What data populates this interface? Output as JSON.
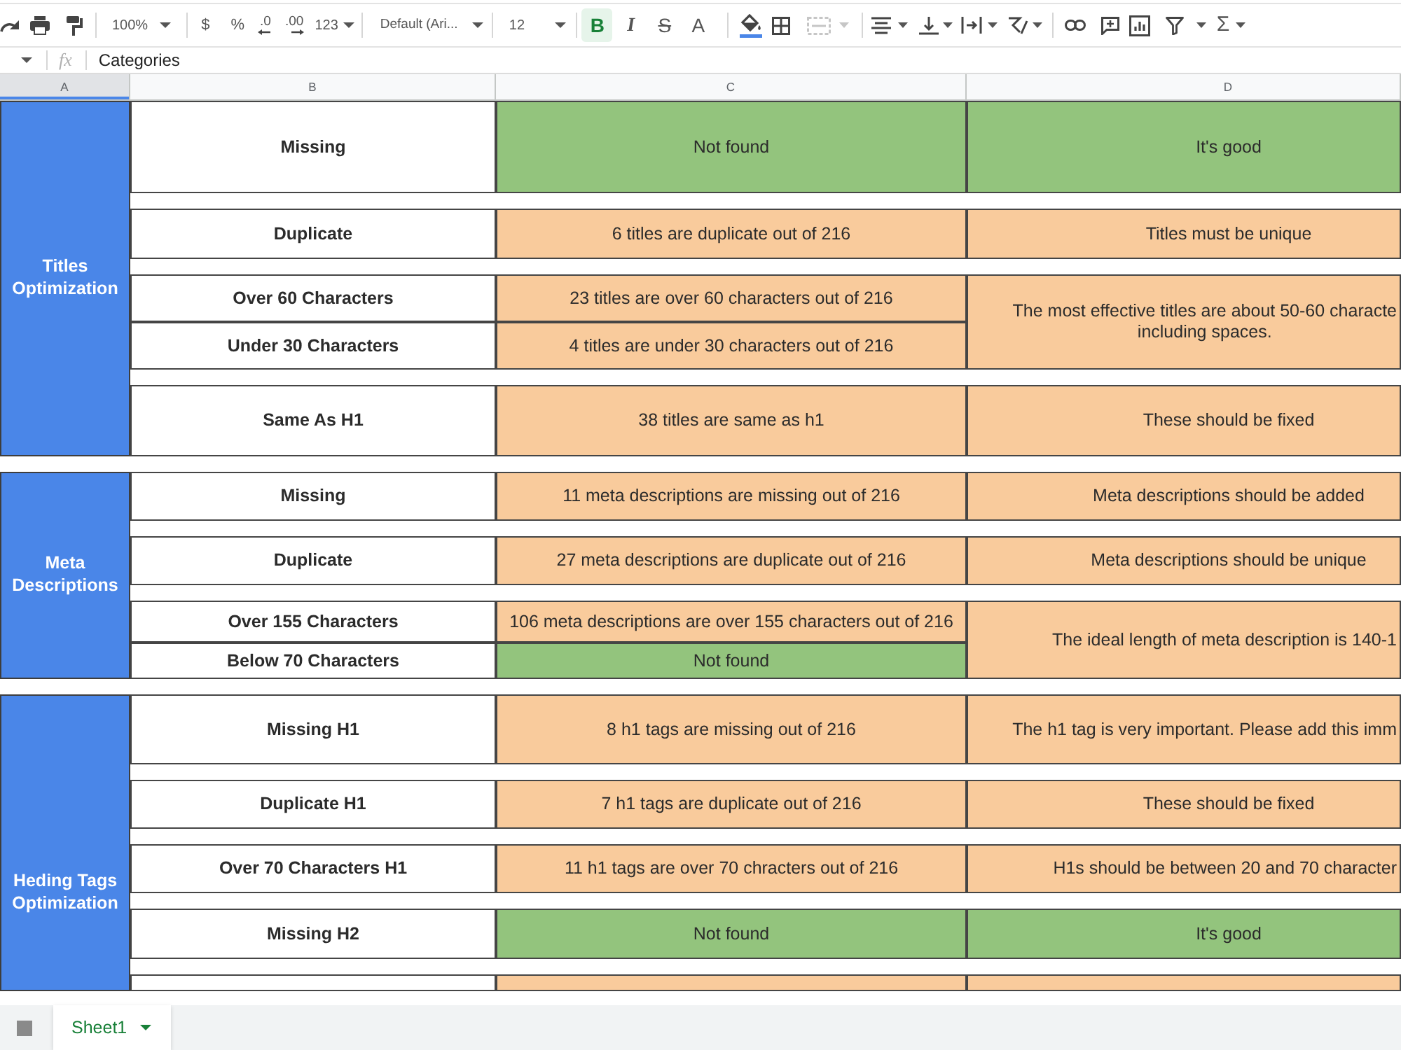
{
  "toolbar": {
    "zoom": "100%",
    "currency": "$",
    "percent": "%",
    "decrease_decimals": ".0",
    "increase_decimals": ".00",
    "number_formats": "123",
    "font": "Default (Ari...",
    "font_size": "12",
    "text_styles": [
      {
        "label": "B",
        "selected": true
      },
      {
        "label": "I",
        "selected": false
      },
      {
        "label": "S",
        "selected": false
      },
      {
        "label": "A",
        "selected": false
      }
    ],
    "merge": {
      "disabled": true
    },
    "functions": "Σ"
  },
  "formula_bar": {
    "label": "fx",
    "value": "Categories"
  },
  "columns": [
    {
      "label": "A",
      "selected": true
    },
    {
      "label": "B",
      "selected": false
    },
    {
      "label": "C",
      "selected": false
    },
    {
      "label": "D",
      "selected": false
    }
  ],
  "groups": [
    {
      "category": "Titles Optimization",
      "blocks": [
        {
          "rows": [
            {
              "check": "Missing",
              "result": "Not found",
              "color": "#93c47d"
            }
          ],
          "advice": {
            "text": "It's good",
            "color": "#93c47d"
          }
        },
        {
          "rows": [
            {
              "check": "Duplicate",
              "result": "6 titles are duplicate out of 216",
              "color": "#f9cb9c"
            }
          ],
          "advice": {
            "text": "Titles must be unique",
            "color": "#f9cb9c"
          }
        },
        {
          "rows": [
            {
              "check": "Over 60 Characters",
              "result": "23 titles are over 60 characters out of 216",
              "color": "#f9cb9c"
            },
            {
              "check": "Under 30 Characters",
              "result": "4 titles are under 30 characters out of 216",
              "color": "#f9cb9c"
            }
          ],
          "advice": {
            "text": "The most effective titles are about 50-60 characte\nincluding spaces.",
            "color": "#f9cb9c"
          }
        },
        {
          "rows": [
            {
              "check": "Same As H1",
              "result": "38 titles are same as h1",
              "color": "#f9cb9c"
            }
          ],
          "advice": {
            "text": "These should be fixed",
            "color": "#f9cb9c"
          }
        }
      ]
    },
    {
      "category": "Meta Descriptions",
      "blocks": [
        {
          "rows": [
            {
              "check": "Missing",
              "result": "11 meta descriptions are missing out of 216",
              "color": "#f9cb9c"
            }
          ],
          "advice": {
            "text": "Meta descriptions should be added",
            "color": "#f9cb9c"
          }
        },
        {
          "rows": [
            {
              "check": "Duplicate",
              "result": "27 meta descriptions are duplicate out of 216",
              "color": "#f9cb9c"
            }
          ],
          "advice": {
            "text": "Meta descriptions should be unique",
            "color": "#f9cb9c"
          }
        },
        {
          "rows": [
            {
              "check": "Over 155 Characters",
              "result": "106 meta descriptions are over 155 characters out of 216",
              "color": "#f9cb9c"
            },
            {
              "check": "Below 70 Characters",
              "result": "Not found",
              "color": "#93c47d"
            }
          ],
          "advice": {
            "text": "The ideal length of meta description is 140-1",
            "color": "#f9cb9c"
          }
        }
      ]
    },
    {
      "category": "Heding Tags Optimization",
      "blocks": [
        {
          "rows": [
            {
              "check": "Missing H1",
              "result": "8 h1 tags are missing out of 216",
              "color": "#f9cb9c"
            }
          ],
          "advice": {
            "text": "The h1 tag is very important. Please add this imm",
            "color": "#f9cb9c"
          }
        },
        {
          "rows": [
            {
              "check": "Duplicate H1",
              "result": "7 h1 tags are duplicate out of 216",
              "color": "#f9cb9c"
            }
          ],
          "advice": {
            "text": "These should be fixed",
            "color": "#f9cb9c"
          }
        },
        {
          "rows": [
            {
              "check": "Over 70 Characters H1",
              "result": "11 h1 tags are over 70 chracters out of 216",
              "color": "#f9cb9c"
            }
          ],
          "advice": {
            "text": "H1s should be between 20 and 70 character",
            "color": "#f9cb9c"
          }
        },
        {
          "rows": [
            {
              "check": "Missing H2",
              "result": "Not found",
              "color": "#93c47d"
            }
          ],
          "advice": {
            "text": "It's good",
            "color": "#93c47d"
          }
        },
        {
          "rows": [
            {
              "color": "#f9cb9c"
            }
          ],
          "advice": {
            "color": "#f9cb9c"
          }
        }
      ]
    }
  ],
  "sheets": [
    {
      "label": "Sheet1",
      "selected": true
    }
  ]
}
